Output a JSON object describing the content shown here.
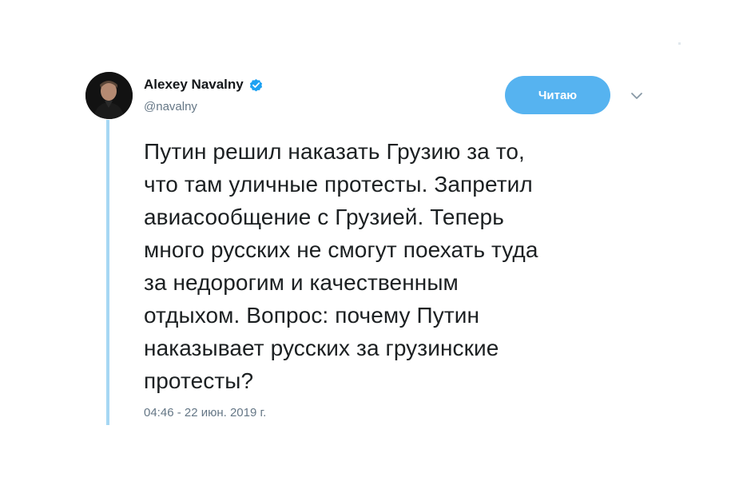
{
  "author": {
    "name": "Alexey Navalny",
    "handle": "@navalny",
    "verified": true,
    "avatar_icon": "avatar-photo"
  },
  "follow_button": {
    "label": "Читаю"
  },
  "menu_icon": "chevron-down-icon",
  "tweet": {
    "text": "Путин решил наказать Грузию за то,\nчто там уличные протесты. Запретил\nавиасообщение с Грузией. Теперь\nмного русских не смогут поехать туда\nза недорогим и качественным\nотдыхом. Вопрос: почему Путин\nнаказывает русских за грузинские\nпротесты?",
    "timestamp": "04:46 - 22 июн. 2019 г."
  },
  "colors": {
    "accent": "#56b3f0",
    "thread_line": "#a6d7f3",
    "text": "#1c2022",
    "secondary_text": "#657786",
    "verified_badge": "#1da1f2"
  }
}
